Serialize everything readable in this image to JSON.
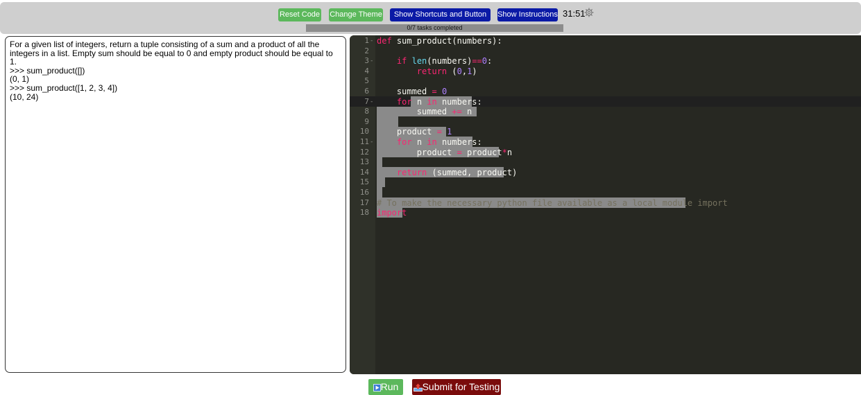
{
  "toolbar": {
    "reset_label": "Reset Code",
    "theme_label": "Change Theme",
    "shortcuts_label": "Show Shortcuts and Button Info",
    "instructions_label": "Show Instructions",
    "timer": "31:51",
    "settings_icon": "gear-icon"
  },
  "progress": {
    "completed": 0,
    "total": 7,
    "text": "0/7 tasks completed",
    "fill_color": "#5cb85c",
    "track_color": "#8c8c8c"
  },
  "instructions": {
    "lines": [
      "For a given list of integers, return a tuple consisting of a sum and a product of all the integers in a list. Empty sum should be equal to 0 and empty product should be equal to 1.",
      ">>> sum_product([])",
      "(0, 1)",
      ">>> sum_product([1, 2, 3, 4])",
      "(10, 24)"
    ]
  },
  "editor": {
    "theme": "monokai",
    "current_line": 7,
    "lines": [
      "def sum_product(numbers):",
      "",
      "    if len(numbers)==0:",
      "        return (0,1)",
      "",
      "    summed = 0",
      "    for n in numbers:",
      "        summed += n",
      "",
      "    product = 1",
      "    for n in numbers:",
      "        product = product*n",
      "",
      "    return (summed, product)",
      "",
      "",
      "# To make the necessary python file available as a local module import",
      "import"
    ]
  },
  "actions": {
    "run_label": "Run",
    "submit_label": "Submit for Testing",
    "run_color": "#5cb85c",
    "submit_color": "#7a0c0c"
  }
}
